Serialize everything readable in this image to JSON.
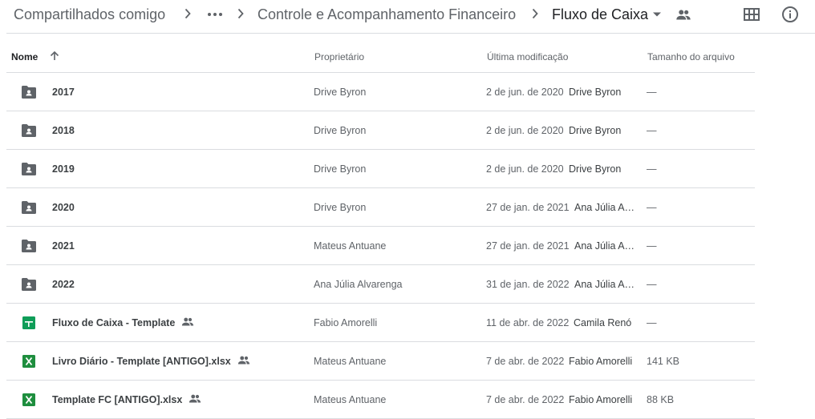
{
  "breadcrumb": {
    "root": "Compartilhados comigo",
    "ellipsis": "•••",
    "parent": "Controle e Acompanhamento Financeiro",
    "current": "Fluxo de Caixa"
  },
  "header_icons": [
    "grid-view-icon",
    "info-icon"
  ],
  "columns": {
    "name": "Nome",
    "owner": "Proprietário",
    "modified": "Última modificação",
    "size": "Tamanho do arquivo"
  },
  "sort": {
    "column": "name",
    "direction": "ascending"
  },
  "rows": [
    {
      "type": "folder",
      "name": "2017",
      "shared": false,
      "owner": "Drive Byron",
      "modified_date": "2 de jun. de 2020",
      "modified_by": "Drive Byron",
      "size": "—"
    },
    {
      "type": "folder",
      "name": "2018",
      "shared": false,
      "owner": "Drive Byron",
      "modified_date": "2 de jun. de 2020",
      "modified_by": "Drive Byron",
      "size": "—"
    },
    {
      "type": "folder",
      "name": "2019",
      "shared": false,
      "owner": "Drive Byron",
      "modified_date": "2 de jun. de 2020",
      "modified_by": "Drive Byron",
      "size": "—"
    },
    {
      "type": "folder",
      "name": "2020",
      "shared": false,
      "owner": "Drive Byron",
      "modified_date": "27 de jan. de 2021",
      "modified_by": "Ana Júlia A…",
      "size": "—"
    },
    {
      "type": "folder",
      "name": "2021",
      "shared": false,
      "owner": "Mateus Antuane",
      "modified_date": "27 de jan. de 2021",
      "modified_by": "Ana Júlia A…",
      "size": "—"
    },
    {
      "type": "folder",
      "name": "2022",
      "shared": false,
      "owner": "Ana Júlia Alvarenga",
      "modified_date": "31 de jan. de 2022",
      "modified_by": "Ana Júlia A…",
      "size": "—"
    },
    {
      "type": "sheets",
      "name": "Fluxo de Caixa - Template",
      "shared": true,
      "owner": "Fabio Amorelli",
      "modified_date": "11 de abr. de 2022",
      "modified_by": "Camila Renó",
      "size": "—"
    },
    {
      "type": "excel",
      "name": "Livro Diário - Template [ANTIGO].xlsx",
      "shared": true,
      "owner": "Mateus Antuane",
      "modified_date": "7 de abr. de 2022",
      "modified_by": "Fabio Amorelli",
      "size": "141 KB"
    },
    {
      "type": "excel",
      "name": "Template FC [ANTIGO].xlsx",
      "shared": true,
      "owner": "Mateus Antuane",
      "modified_date": "7 de abr. de 2022",
      "modified_by": "Fabio Amorelli",
      "size": "88 KB"
    }
  ],
  "colors": {
    "folder": "#5f6368",
    "sheets": "#0f9d58",
    "excel": "#1e8e3e",
    "divider": "#dadce0"
  }
}
